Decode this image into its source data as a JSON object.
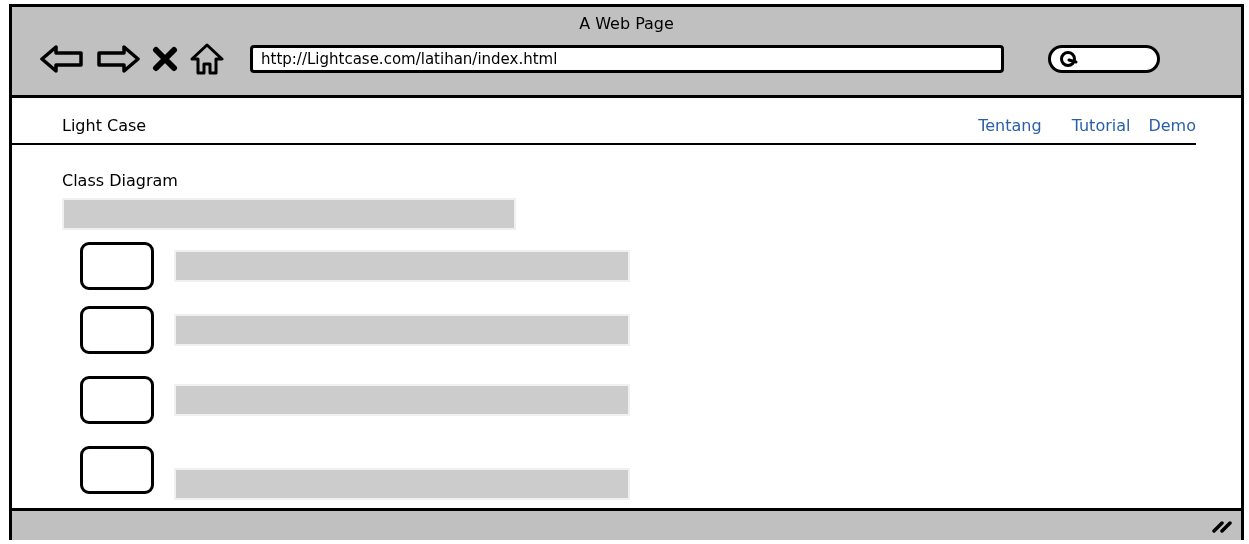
{
  "window": {
    "title": "A Web Page"
  },
  "address_bar": {
    "value": "http://Lightcase.com/latihan/index.html"
  },
  "nav": {
    "brand": "Light Case",
    "links": [
      "Tentang",
      "Tutorial",
      "Demo"
    ]
  },
  "content": {
    "heading": "Class Diagram",
    "items": [
      {
        "checked": false
      },
      {
        "checked": false
      },
      {
        "checked": false
      },
      {
        "checked": false
      }
    ]
  }
}
